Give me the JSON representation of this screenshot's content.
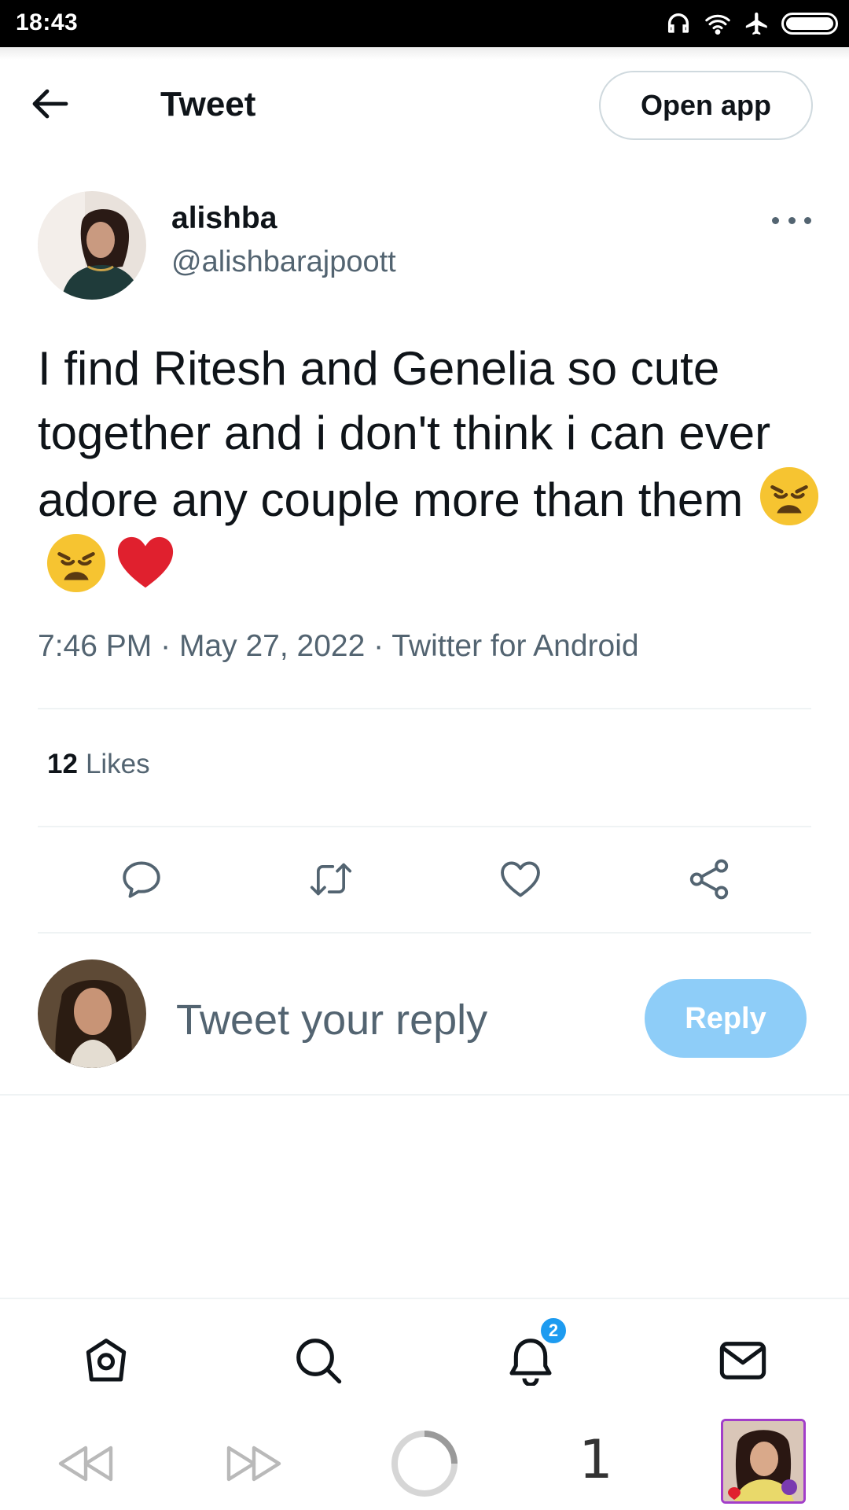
{
  "status_bar": {
    "time": "18:43",
    "icons": [
      "headphones-icon",
      "wifi-icon",
      "airplane-icon",
      "battery-icon"
    ]
  },
  "header": {
    "back_icon": "arrow-left-icon",
    "title": "Tweet",
    "open_app_label": "Open app"
  },
  "tweet": {
    "author_name": "alishba",
    "author_handle": "@alishbarajpoott",
    "more_icon": "more-horizontal-icon",
    "text": "I find Ritesh and Genelia so cute together and i don't think i can ever adore any couple more than them",
    "emojis": [
      "weary-face",
      "weary-face",
      "red-heart"
    ],
    "time": "7:46 PM",
    "date": "May 27, 2022",
    "source": "Twitter for Android",
    "separator": "·",
    "likes_count": "12",
    "likes_label": "Likes"
  },
  "actions": [
    "reply-icon",
    "retweet-icon",
    "like-icon",
    "share-icon"
  ],
  "composer": {
    "placeholder": "Tweet your reply",
    "reply_label": "Reply"
  },
  "bottom_nav": {
    "items": [
      "home-icon",
      "search-icon",
      "notifications-icon",
      "messages-icon"
    ],
    "notification_badge": "2"
  },
  "browser_bar": {
    "items": [
      "rewind-icon",
      "fast-forward-icon",
      "loading-spinner-icon"
    ],
    "tab_count": "1"
  },
  "colors": {
    "accent": "#1d9bf0",
    "reply_button": "#8ecdf8",
    "secondary_text": "#536471",
    "divider": "#eff3f4",
    "tab_border": "#a23ec9"
  }
}
